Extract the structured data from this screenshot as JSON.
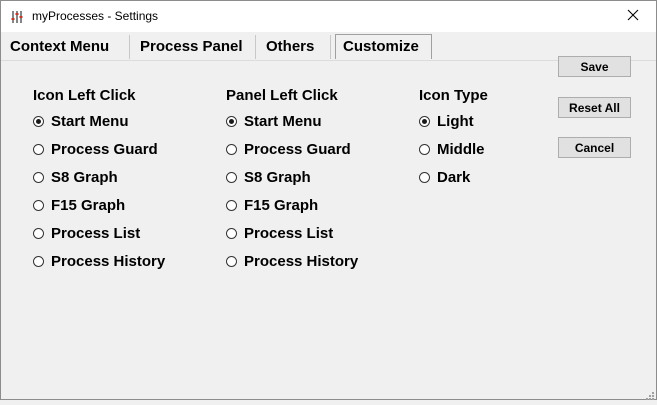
{
  "window": {
    "title": "myProcesses - Settings"
  },
  "tabs": [
    {
      "label": "Context Menu"
    },
    {
      "label": "Process Panel"
    },
    {
      "label": "Others"
    },
    {
      "label": "Customize",
      "selected": true
    }
  ],
  "icon_left_click": {
    "heading": "Icon Left Click",
    "options": [
      {
        "label": "Start Menu",
        "checked": true
      },
      {
        "label": "Process Guard",
        "checked": false
      },
      {
        "label": "S8 Graph",
        "checked": false
      },
      {
        "label": "F15 Graph",
        "checked": false
      },
      {
        "label": "Process List",
        "checked": false
      },
      {
        "label": "Process History",
        "checked": false
      }
    ]
  },
  "panel_left_click": {
    "heading": "Panel Left Click",
    "options": [
      {
        "label": "Start Menu",
        "checked": true
      },
      {
        "label": "Process Guard",
        "checked": false
      },
      {
        "label": "S8 Graph",
        "checked": false
      },
      {
        "label": "F15 Graph",
        "checked": false
      },
      {
        "label": "Process List",
        "checked": false
      },
      {
        "label": "Process History",
        "checked": false
      }
    ]
  },
  "icon_type": {
    "heading": "Icon Type",
    "options": [
      {
        "label": "Light",
        "checked": true
      },
      {
        "label": "Middle",
        "checked": false
      },
      {
        "label": "Dark",
        "checked": false
      }
    ]
  },
  "buttons": {
    "save": "Save",
    "reset_all": "Reset All",
    "cancel": "Cancel"
  },
  "icons": {
    "app": "sliders-icon",
    "close": "close-icon",
    "resize": "resize-grip-icon"
  }
}
